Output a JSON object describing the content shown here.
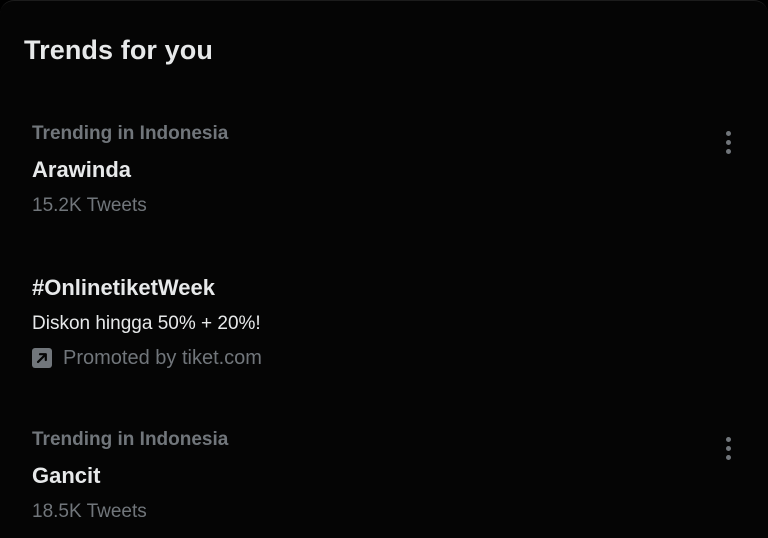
{
  "header": {
    "title": "Trends for you"
  },
  "trends": [
    {
      "context": "Trending in Indonesia",
      "name": "Arawinda",
      "count": "15.2K Tweets"
    },
    {
      "name": "#OnlinetiketWeek",
      "description": "Diskon hingga 50% + 20%!",
      "promoted": "Promoted by tiket.com"
    },
    {
      "context": "Trending in Indonesia",
      "name": "Gancit",
      "count": "18.5K Tweets"
    }
  ],
  "icons": {
    "more": "more-vertical-icon",
    "promoted": "promoted-arrow-icon"
  },
  "colors": {
    "background": "#050505",
    "primary_text": "#e7e9ea",
    "secondary_text": "#71767b"
  }
}
